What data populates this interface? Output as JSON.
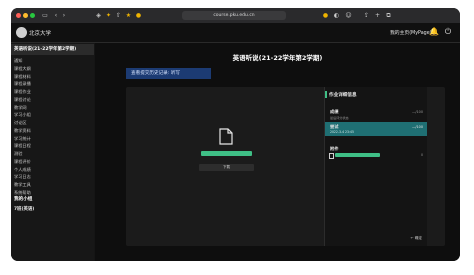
{
  "browser": {
    "url": "course.pku.edu.cn",
    "nav": {
      "back_icon": "chevron-left-icon",
      "forward_icon": "chevron-right-icon"
    }
  },
  "header": {
    "logo_text": "北京大学",
    "my_homepage": "我的主页(MyPage)"
  },
  "sidebar": {
    "course_title": "英语听说(21-22学年第2学期)",
    "items": [
      "通知",
      "课程大纲",
      "课程材料",
      "课程录播",
      "课程作业",
      "课程讨论",
      "教学网",
      "学习小组",
      "讨论区",
      "教学资料",
      "学习统计",
      "课程日程",
      "测验",
      "课程评价",
      "个人成绩",
      "学习日志",
      "教学工具",
      "系统帮助"
    ],
    "group_title": "我的小组",
    "group_item": "7班(英语)"
  },
  "main": {
    "page_title": "英语听说(21-22学年第2学期)",
    "history_button": "查看提交历史记录: 听写",
    "download_button": "下载"
  },
  "info_panel": {
    "title": "作业详细信息",
    "rows": [
      {
        "label": "成绩",
        "sub": "最后评分状态",
        "value": "—/100"
      },
      {
        "label": "尝试",
        "sub": "2022-3-4 23:45",
        "value": "—/100"
      }
    ],
    "attachments_label": "附件",
    "attachment_count": "0",
    "back_label": "← 确定"
  },
  "colors": {
    "accent": "#3fbf86",
    "history_btn": "#1c3b73",
    "active_row": "#1f6f73"
  }
}
